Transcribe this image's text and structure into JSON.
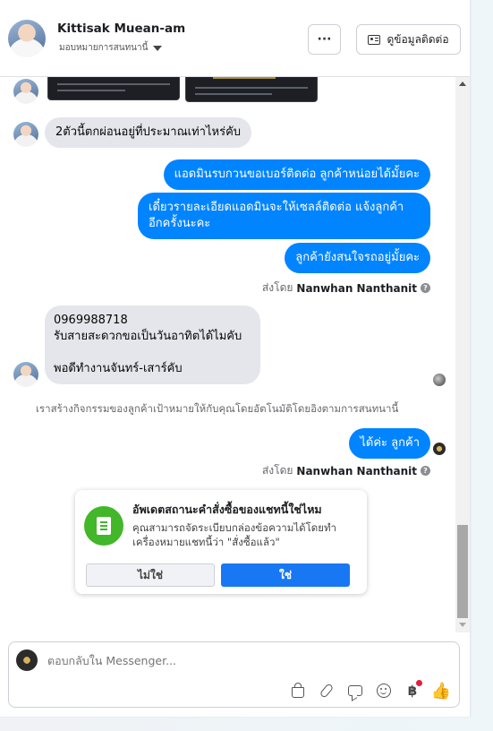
{
  "header": {
    "name": "Kittisak Muean-am",
    "assign_label": "มอบหมายการสนทนานี้",
    "more_label": "···",
    "contact_label": "ดูข้อมูลติดต่อ"
  },
  "messages": {
    "incoming_1": "2ตัวนี้ตกผ่อนอยู่ที่ประมาณเท่าไหร่คับ",
    "outgoing_1": "แอดมินรบกวนขอเบอร์ติดต่อ ลูกค้าหน่อยได้มั้ยคะ",
    "outgoing_2_line1": "เดี๋ยวรายละเอียดแอดมินจะให้เซลล์ติดต่อ แจ้งลูกค้า",
    "outgoing_2_line2": "อีกครั้งนะคะ",
    "outgoing_3": "ลูกค้ายังสนใจรถอยู่มั้ยคะ",
    "sent_by_prefix_1": "ส่งโดย",
    "sent_by_name_1": "Nanwhan Nanthanit",
    "incoming_2_line1": "0969988718",
    "incoming_2_line2": "รับสายสะดวกขอเป็นวันอาทิตได้ไมคับ",
    "incoming_2_line3": "พอดีทำงานจันทร์-เสาร์คับ",
    "system_note": "เราสร้างกิจกรรมของลูกค้าเป้าหมายให้กับคุณโดยอัตโนมัติโดยอิงตามการสนทนานี้",
    "outgoing_4": "ได้ค่ะ ลูกค้า",
    "sent_by_prefix_2": "ส่งโดย",
    "sent_by_name_2": "Nanwhan Nanthanit"
  },
  "suggestion": {
    "title": "อัพเดตสถานะคำสั่งซื้อของแชทนี้ใช่ไหม",
    "body": "คุณสามารถจัดระเบียบกล่องข้อความได้โดยทำเครื่องหมายแชทนี้ว่า \"สั่งซื้อแล้ว\"",
    "no_label": "ไม่ใช่",
    "yes_label": "ใช่"
  },
  "composer": {
    "placeholder": "ตอบกลับใน Messenger..."
  },
  "icons": [
    "shopping-bag-icon",
    "paperclip-icon",
    "saved-reply-icon",
    "emoji-icon",
    "baht-payment-icon",
    "thumbs-up-icon"
  ],
  "colors": {
    "outgoing_bubble": "#0084ff",
    "incoming_bubble": "#e4e6eb",
    "primary_button": "#1877f2",
    "suggest_icon": "#42b72a"
  }
}
